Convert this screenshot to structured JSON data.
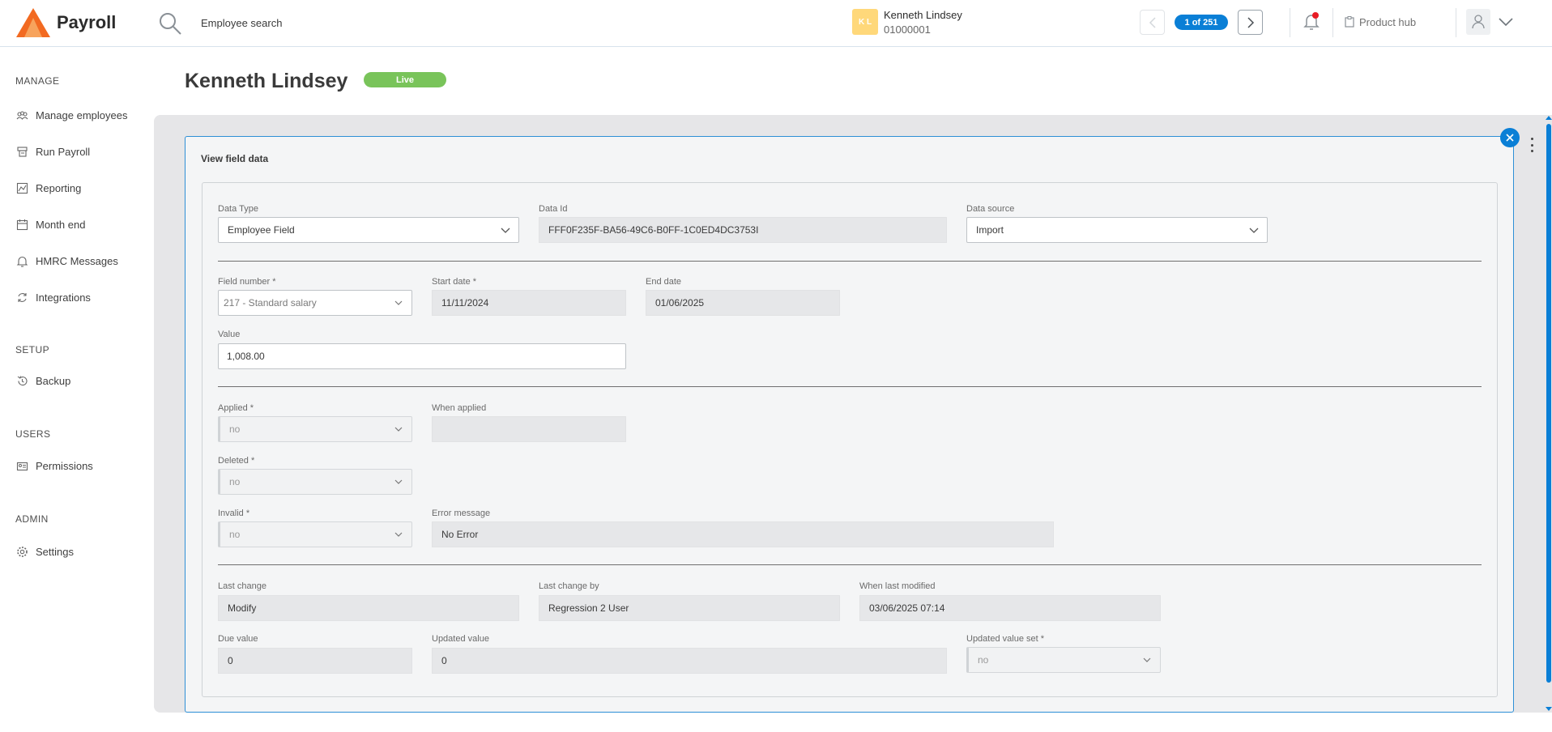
{
  "header": {
    "app_name": "Payroll",
    "search_placeholder": "Employee search",
    "employee_initials": "K L",
    "employee_name": "Kenneth Lindsey",
    "employee_code": "01000001",
    "record_position": "1 of 251",
    "product_hub_label": "Product hub",
    "brand_color": "#f26a21",
    "accent_color": "#0a7fd6"
  },
  "sidebar": {
    "sections": [
      {
        "title": "MANAGE",
        "items": [
          {
            "label": "Manage employees",
            "icon": "people-icon"
          },
          {
            "label": "Run Payroll",
            "icon": "payroll-icon"
          },
          {
            "label": "Reporting",
            "icon": "chart-icon"
          },
          {
            "label": "Month end",
            "icon": "calendar-icon"
          },
          {
            "label": "HMRC Messages",
            "icon": "bell-icon"
          },
          {
            "label": "Integrations",
            "icon": "sync-icon"
          }
        ]
      },
      {
        "title": "SETUP",
        "items": [
          {
            "label": "Backup",
            "icon": "history-icon"
          }
        ]
      },
      {
        "title": "USERS",
        "items": [
          {
            "label": "Permissions",
            "icon": "permissions-icon"
          }
        ]
      },
      {
        "title": "ADMIN",
        "items": [
          {
            "label": "Settings",
            "icon": "gear-icon"
          }
        ]
      }
    ]
  },
  "page": {
    "title": "Kenneth Lindsey",
    "status_badge": "Live",
    "status_color": "#79c45a"
  },
  "panel": {
    "title": "View field data",
    "fields": {
      "data_type": {
        "label": "Data Type",
        "value": "Employee Field"
      },
      "data_id": {
        "label": "Data Id",
        "value": "FFF0F235F-BA56-49C6-B0FF-1C0ED4DC3753I"
      },
      "data_source": {
        "label": "Data source",
        "value": "Import"
      },
      "field_number": {
        "label": "Field number *",
        "value": "217 - Standard salary"
      },
      "start_date": {
        "label": "Start date *",
        "value": "11/11/2024"
      },
      "end_date": {
        "label": "End date",
        "value": "01/06/2025"
      },
      "value": {
        "label": "Value",
        "value": "1,008.00"
      },
      "applied": {
        "label": "Applied *",
        "value": "no"
      },
      "when_applied": {
        "label": "When applied",
        "value": ""
      },
      "deleted": {
        "label": "Deleted *",
        "value": "no"
      },
      "invalid": {
        "label": "Invalid *",
        "value": "no"
      },
      "error_message": {
        "label": "Error message",
        "value": "No Error"
      },
      "last_change": {
        "label": "Last change",
        "value": "Modify"
      },
      "last_change_by": {
        "label": "Last change by",
        "value": "Regression 2 User"
      },
      "when_last_modified": {
        "label": "When last modified",
        "value": "03/06/2025 07:14"
      },
      "due_value": {
        "label": "Due value",
        "value": "0"
      },
      "updated_value": {
        "label": "Updated value",
        "value": "0"
      },
      "updated_value_set": {
        "label": "Updated value set *",
        "value": "no"
      }
    }
  }
}
